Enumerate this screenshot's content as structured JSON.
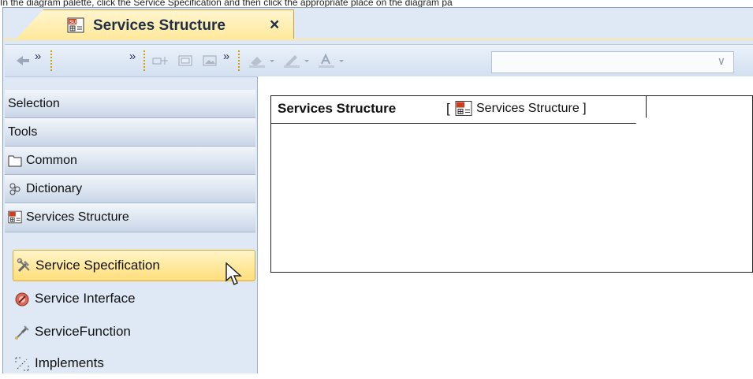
{
  "caption": "In the diagram palette, click the Service Specification and then click the appropriate place on the diagram pa",
  "tab": {
    "title": "Services Structure",
    "close": "×"
  },
  "toolbar": {
    "chevron": "»",
    "dropdown_arrow": "∨"
  },
  "palette": {
    "selection": "Selection",
    "tools": "Tools",
    "common": "Common",
    "dictionary": "Dictionary",
    "group": "Services Structure"
  },
  "tools": [
    {
      "label": "Service Specification",
      "icon": "service-specification-icon",
      "selected": true
    },
    {
      "label": "Service Interface",
      "icon": "service-interface-icon",
      "selected": false
    },
    {
      "label": "ServiceFunction",
      "icon": "service-function-icon",
      "selected": false
    },
    {
      "label": "Implements",
      "icon": "implements-icon",
      "selected": false
    }
  ],
  "diagram": {
    "name": "Services Structure",
    "open_bracket": "[",
    "type": "Services Structure ]"
  },
  "colors": {
    "selected_tab": "#ffe899",
    "selected_tool": "#ffde7a",
    "palette_header": "#c9d6e7"
  }
}
